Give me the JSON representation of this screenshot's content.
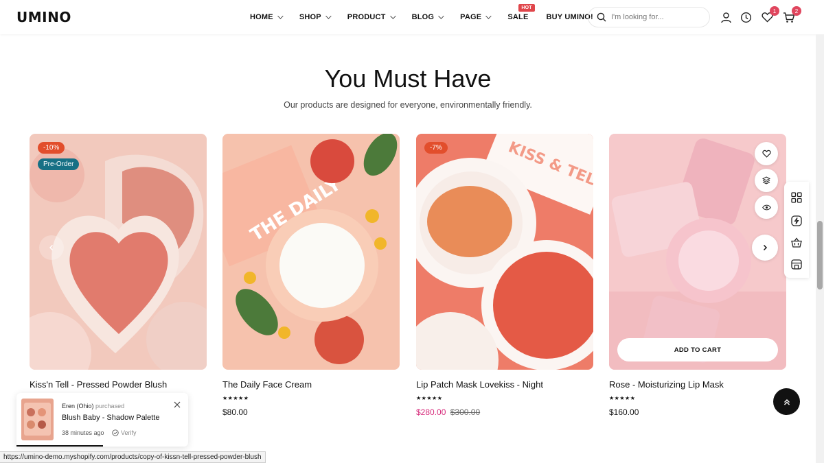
{
  "header": {
    "logo": "UMINO",
    "nav": [
      {
        "label": "HOME",
        "dropdown": true
      },
      {
        "label": "SHOP",
        "dropdown": true
      },
      {
        "label": "PRODUCT",
        "dropdown": true
      },
      {
        "label": "BLOG",
        "dropdown": true
      },
      {
        "label": "PAGE",
        "dropdown": true
      },
      {
        "label": "SALE",
        "dropdown": false,
        "badge": "HOT"
      },
      {
        "label": "BUY UMINO!",
        "dropdown": false
      }
    ],
    "search_placeholder": "I'm looking for...",
    "wishlist_count": "1",
    "cart_count": "2"
  },
  "section": {
    "title": "You Must Have",
    "subtitle": "Our products are designed for everyone, environmentally friendly."
  },
  "products": [
    {
      "name": "Kiss'n Tell - Pressed Powder Blush",
      "badge_discount": "-10%",
      "badge_preorder": "Pre-Order",
      "rating": "★★★★★",
      "price": "",
      "old_price": ""
    },
    {
      "name": "The Daily Face Cream",
      "rating": "★★★★★",
      "price": "$80.00",
      "old_price": ""
    },
    {
      "name": "Lip Patch Mask Lovekiss - Night",
      "badge_discount": "-7%",
      "rating": "★★★★★",
      "price": "$280.00",
      "old_price": "$300.00"
    },
    {
      "name": "Rose - Moisturizing Lip Mask",
      "rating": "★★★★★",
      "price": "$160.00",
      "old_price": "",
      "add_to_cart": "ADD TO CART"
    }
  ],
  "notification": {
    "buyer": "Eren (Ohio)",
    "action": "purchased",
    "product": "Blush Baby - Shadow Palette",
    "time": "38 minutes ago",
    "verify": "Verify"
  },
  "status_url": "https://umino-demo.myshopify.com/products/copy-of-kissn-tell-pressed-powder-blush",
  "colors": {
    "sale_price": "#d6297a",
    "discount_badge": "#e24e2c",
    "preorder_badge": "#177085",
    "count_badge": "#e0465e"
  }
}
